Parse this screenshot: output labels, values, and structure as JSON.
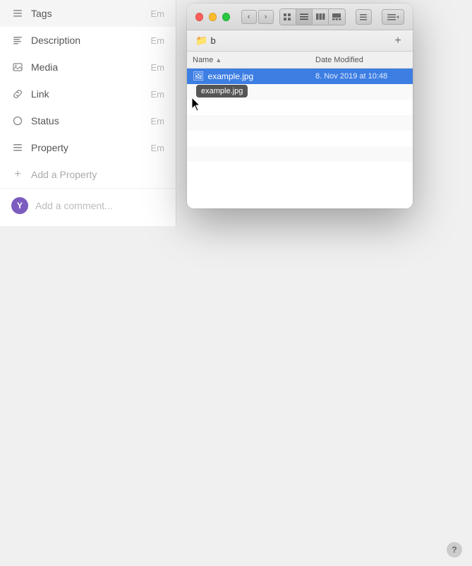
{
  "sidebar": {
    "items": [
      {
        "id": "tags",
        "label": "Tags",
        "value": "Em",
        "icon": "list"
      },
      {
        "id": "description",
        "label": "Description",
        "value": "Em",
        "icon": "text"
      },
      {
        "id": "media",
        "label": "Media",
        "value": "Em",
        "icon": "image"
      },
      {
        "id": "link",
        "label": "Link",
        "value": "Em",
        "icon": "link"
      },
      {
        "id": "status",
        "label": "Status",
        "value": "Em",
        "icon": "circle"
      },
      {
        "id": "property",
        "label": "Property",
        "value": "Em",
        "icon": "text"
      }
    ],
    "add_property_label": "Add a Property",
    "add_comment_label": "Add a comment...",
    "avatar_initial": "Y"
  },
  "finder": {
    "title": "b",
    "folder_name": "b",
    "nav": {
      "back_label": "‹",
      "forward_label": "›"
    },
    "toolbar": {
      "add_label": "+"
    },
    "headers": {
      "name_label": "Name",
      "modified_label": "Date Modified",
      "sort_indicator": "▲"
    },
    "files": [
      {
        "name": "example.jpg",
        "modified": "8. Nov 2019 at 10:48",
        "selected": true
      }
    ],
    "tooltip": {
      "text": "example.jpg",
      "visible": true
    }
  },
  "help": {
    "label": "?"
  },
  "colors": {
    "accent": "#3d7ee3",
    "avatar_bg": "#7c5cbf",
    "folder": "#4a90d9"
  }
}
